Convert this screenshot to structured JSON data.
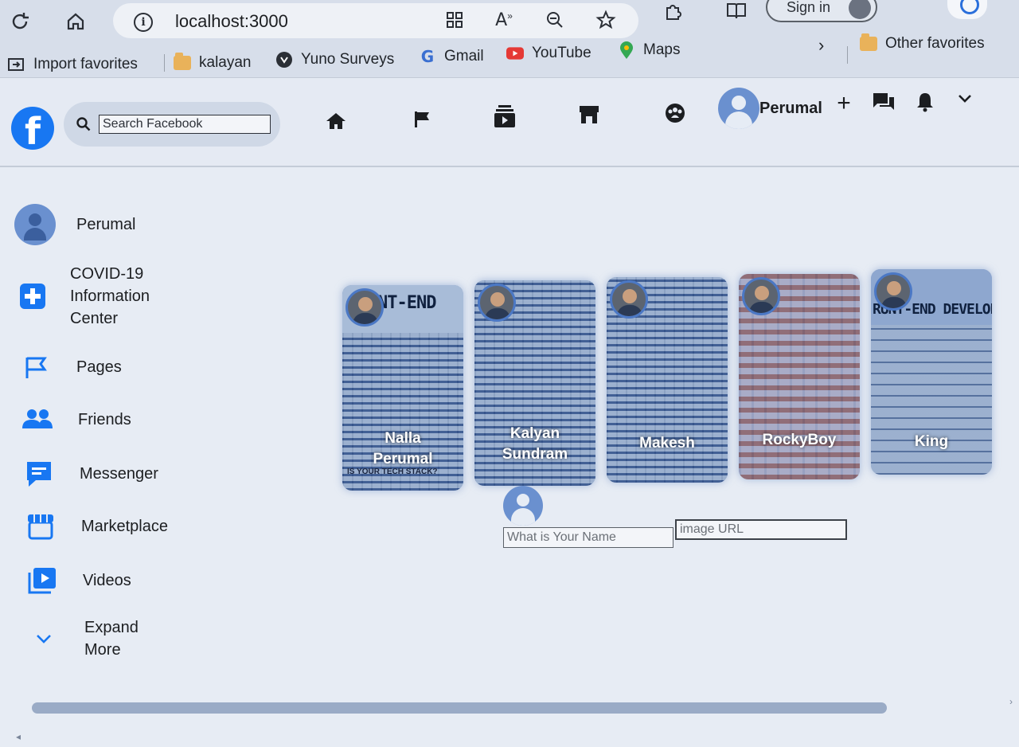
{
  "browser": {
    "url": "localhost:3000",
    "sign_in_label": "Sign in",
    "favorites": [
      {
        "label": "Import favorites",
        "icon": "import-icon"
      },
      {
        "label": "kalayan",
        "icon": "folder-icon"
      },
      {
        "label": "Yuno Surveys",
        "icon": "yuno-icon"
      },
      {
        "label": "Gmail",
        "icon": "google-icon"
      },
      {
        "label": "YouTube",
        "icon": "youtube-icon"
      },
      {
        "label": "Maps",
        "icon": "maps-icon"
      }
    ],
    "other_favorites_label": "Other favorites"
  },
  "header": {
    "search_placeholder": "Search Facebook",
    "user_name": "Perumal"
  },
  "sidebar": {
    "items": [
      {
        "label": "Perumal",
        "icon": "user-avatar"
      },
      {
        "label_lines": [
          "COVID-19",
          "Information",
          "Center"
        ],
        "icon": "covid-info-icon"
      },
      {
        "label": "Pages",
        "icon": "flag-icon"
      },
      {
        "label": "Friends",
        "icon": "friends-icon"
      },
      {
        "label": "Messenger",
        "icon": "messenger-icon"
      },
      {
        "label": "Marketplace",
        "icon": "marketplace-icon"
      },
      {
        "label": "Videos",
        "icon": "videos-icon"
      },
      {
        "label_lines": [
          "Expand",
          "More"
        ],
        "icon": "chevron-down-icon"
      }
    ]
  },
  "stories": [
    {
      "name_lines": [
        "Nalla",
        "Perumal"
      ],
      "title": "NT-END",
      "footer": "IS YOUR TECH STACK?"
    },
    {
      "name_lines": [
        "Kalyan",
        "Sundram"
      ],
      "title": "",
      "footer": ""
    },
    {
      "name_lines": [
        "Makesh"
      ],
      "title": "",
      "footer": ""
    },
    {
      "name_lines": [
        "RockyBoy"
      ],
      "title": "",
      "footer": ""
    },
    {
      "name_lines": [
        "King"
      ],
      "title": "RUNT-END DEVELOP",
      "footer": ""
    }
  ],
  "story_form": {
    "name_placeholder": "What is Your Name",
    "url_placeholder": "image URL"
  },
  "colors": {
    "brand_blue": "#1877f2",
    "page_bg": "#e7ecf4"
  }
}
